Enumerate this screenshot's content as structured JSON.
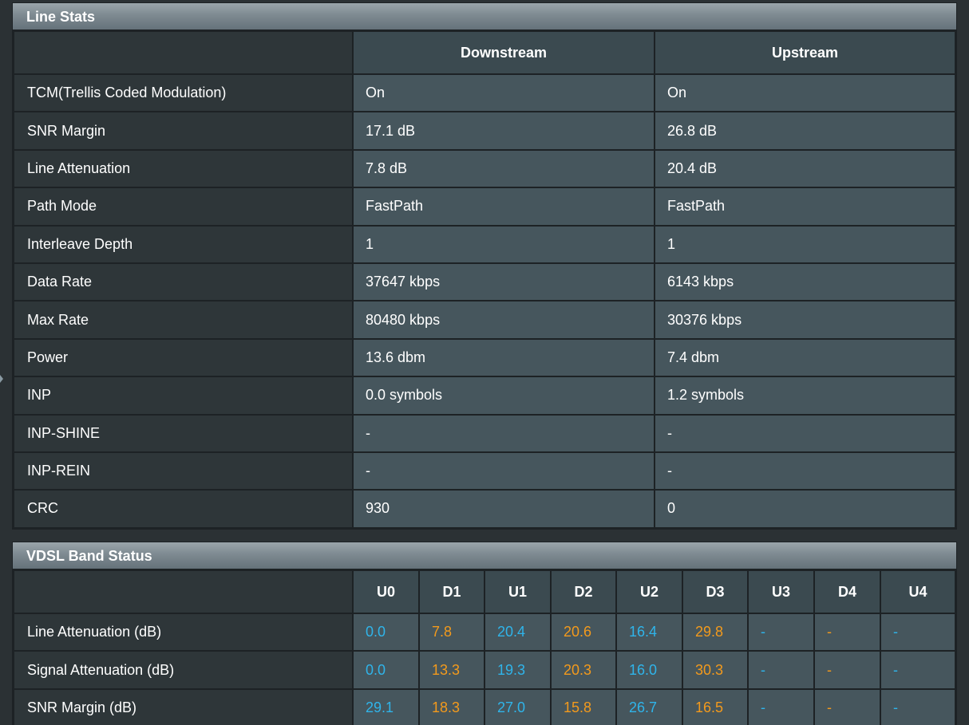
{
  "line_stats": {
    "title": "Line Stats",
    "columns": [
      "Downstream",
      "Upstream"
    ],
    "rows": [
      {
        "label": "TCM(Trellis Coded Modulation)",
        "downstream": "On",
        "upstream": "On"
      },
      {
        "label": "SNR Margin",
        "downstream": "17.1 dB",
        "upstream": "26.8 dB"
      },
      {
        "label": "Line Attenuation",
        "downstream": "7.8 dB",
        "upstream": "20.4 dB"
      },
      {
        "label": "Path Mode",
        "downstream": "FastPath",
        "upstream": "FastPath"
      },
      {
        "label": "Interleave Depth",
        "downstream": "1",
        "upstream": "1"
      },
      {
        "label": "Data Rate",
        "downstream": "37647 kbps",
        "upstream": "6143 kbps"
      },
      {
        "label": "Max Rate",
        "downstream": "80480 kbps",
        "upstream": "30376 kbps"
      },
      {
        "label": "Power",
        "downstream": "13.6 dbm",
        "upstream": "7.4 dbm"
      },
      {
        "label": "INP",
        "downstream": "0.0 symbols",
        "upstream": "1.2 symbols"
      },
      {
        "label": "INP-SHINE",
        "downstream": "-",
        "upstream": "-"
      },
      {
        "label": "INP-REIN",
        "downstream": "-",
        "upstream": "-"
      },
      {
        "label": "CRC",
        "downstream": "930",
        "upstream": "0"
      }
    ]
  },
  "vdsl_band_status": {
    "title": "VDSL Band Status",
    "bands": [
      "U0",
      "D1",
      "U1",
      "D2",
      "U2",
      "D3",
      "U3",
      "D4",
      "U4"
    ],
    "rows": [
      {
        "label": "Line Attenuation (dB)",
        "values": [
          "0.0",
          "7.8",
          "20.4",
          "20.6",
          "16.4",
          "29.8",
          "-",
          "-",
          "-"
        ]
      },
      {
        "label": "Signal Attenuation (dB)",
        "values": [
          "0.0",
          "13.3",
          "19.3",
          "20.3",
          "16.0",
          "30.3",
          "-",
          "-",
          "-"
        ]
      },
      {
        "label": "SNR Margin (dB)",
        "values": [
          "29.1",
          "18.3",
          "27.0",
          "15.8",
          "26.7",
          "16.5",
          "-",
          "-",
          "-"
        ]
      }
    ]
  },
  "colors": {
    "upstream_band": "#2fb4ea",
    "downstream_band": "#f39a1c"
  }
}
